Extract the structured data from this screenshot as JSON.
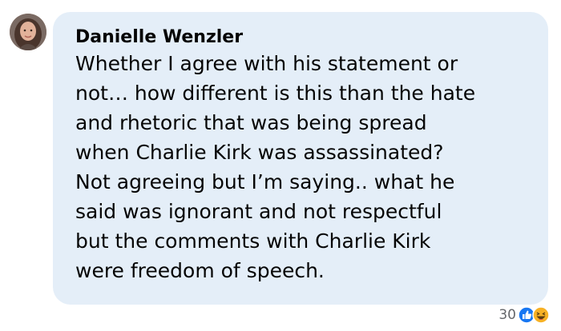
{
  "comment": {
    "author": "Danielle Wenzler",
    "text": "Whether I agree with his statement or\nnot… how different is this than the hate\nand rhetoric that was being spread\nwhen Charlie Kirk was assassinated?\nNot agreeing but I’m saying.. what he\nsaid was ignorant and not respectful\nbut the comments with Charlie Kirk\nwere freedom of speech.",
    "reaction_count": "30",
    "reactions": [
      "like-icon",
      "haha-icon"
    ]
  },
  "colors": {
    "bubble": "#e4eef8",
    "text": "#050505",
    "muted": "#65676b",
    "like": "#1877f2",
    "haha": "#f7b125"
  }
}
